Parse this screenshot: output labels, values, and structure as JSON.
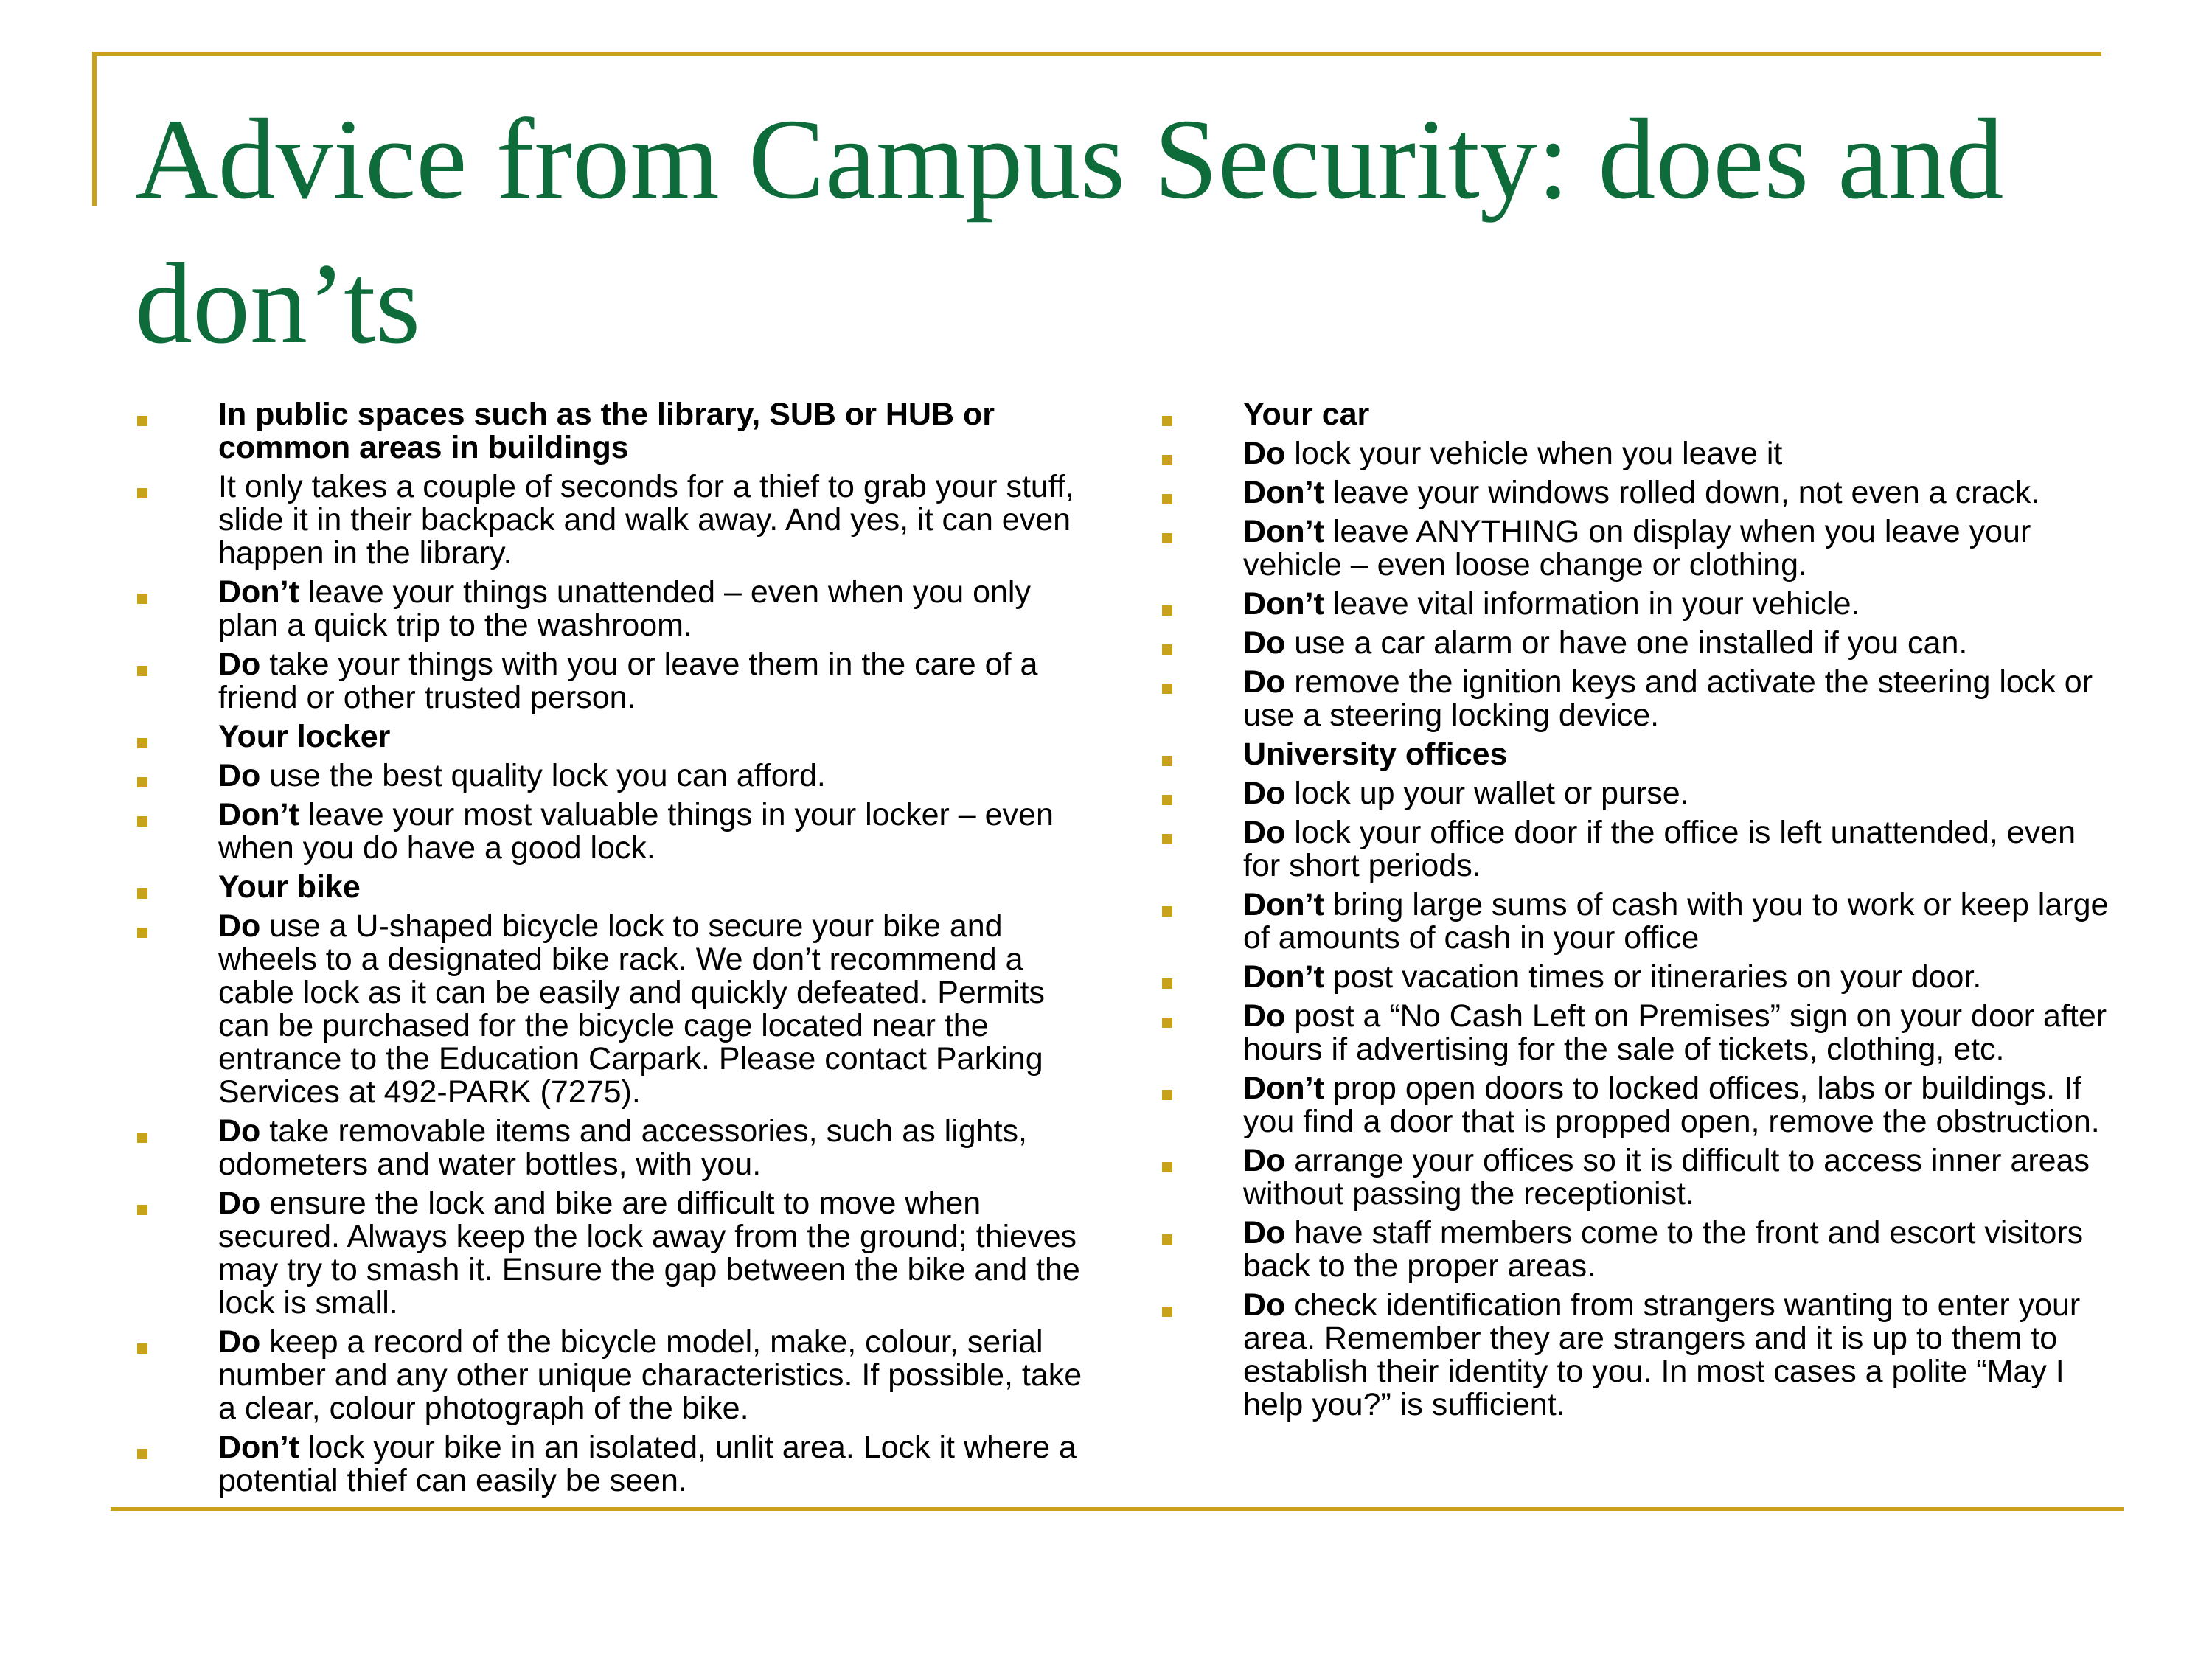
{
  "colors": {
    "accent": "#C9A21B",
    "title": "#0E6B3A"
  },
  "title": "Advice from Campus Security: does and don’ts",
  "left_column": [
    {
      "lead": "In public spaces such as the library, SUB or HUB or common areas in buildings",
      "text": ""
    },
    {
      "lead": "",
      "text": "It only takes a couple of seconds for a thief to grab your stuff, slide it in their backpack and walk away. And yes, it can even happen in the library."
    },
    {
      "lead": "Don’t",
      "text": " leave your things unattended – even when you only plan a quick trip to the washroom."
    },
    {
      "lead": "Do",
      "text": " take your things with you or leave them in the care of a friend or other trusted person."
    },
    {
      "lead": "Your locker",
      "text": ""
    },
    {
      "lead": "Do",
      "text": " use the best quality lock you can afford."
    },
    {
      "lead": "Don’t",
      "text": " leave your most valuable things in your locker – even when you do have a good lock."
    },
    {
      "lead": "Your bike",
      "text": ""
    },
    {
      "lead": "Do",
      "text": " use a U-shaped bicycle lock to secure your bike and wheels to a designated bike rack. We don’t recommend a cable lock as it can be easily and quickly defeated. Permits can be purchased for the bicycle cage located near the entrance to the Education Carpark. Please contact Parking Services at 492-PARK (7275)."
    },
    {
      "lead": "Do",
      "text": " take removable items and accessories, such as lights, odometers and water bottles, with you."
    },
    {
      "lead": "Do",
      "text": " ensure the lock and bike are difficult to move when secured. Always keep the lock away from the ground; thieves may try to smash it. Ensure the gap between the bike and the lock is small."
    },
    {
      "lead": "Do",
      "text": " keep a record of the bicycle model, make, colour, serial number and any other unique characteristics. If possible, take a clear, colour photograph of the bike."
    },
    {
      "lead": "Don’t",
      "text": " lock your bike in an isolated, unlit area. Lock it where a potential thief can easily be seen."
    }
  ],
  "right_column": [
    {
      "lead": "Your car",
      "text": ""
    },
    {
      "lead": "Do",
      "text": " lock your vehicle when you leave it"
    },
    {
      "lead": "Don’t",
      "text": " leave your windows rolled down, not even a crack."
    },
    {
      "lead": "Don’t",
      "text": " leave ANYTHING on display when you leave your vehicle – even loose change or clothing."
    },
    {
      "lead": "Don’t",
      "text": " leave vital information in your vehicle."
    },
    {
      "lead": "Do",
      "text": " use a car alarm or have one installed if you can."
    },
    {
      "lead": "Do",
      "text": " remove the ignition keys and activate the steering lock or use a steering locking device."
    },
    {
      "lead": "University offices",
      "text": ""
    },
    {
      "lead": "Do",
      "text": " lock up your wallet or purse."
    },
    {
      "lead": "Do",
      "text": " lock your office door if the office is left unattended, even for short periods."
    },
    {
      "lead": "Don’t",
      "text": " bring large sums of cash with you to work or keep large of amounts of cash in your office"
    },
    {
      "lead": "Don’t",
      "text": " post vacation times or itineraries on your door."
    },
    {
      "lead": "Do",
      "text": " post a “No Cash Left on Premises” sign on your door after hours if advertising for the sale of tickets, clothing, etc."
    },
    {
      "lead": "Don’t",
      "text": " prop open doors to locked offices, labs or buildings. If you find a door that is propped open, remove the obstruction."
    },
    {
      "lead": "Do",
      "text": " arrange your offices so it is difficult to access inner areas without passing the receptionist."
    },
    {
      "lead": "Do",
      "text": " have staff members come to the front and escort visitors back to the proper areas."
    },
    {
      "lead": "Do",
      "text": " check identification from strangers wanting to enter your area. Remember they are strangers and it is up to them to establish their identity to you. In most cases a polite “May I help you?” is sufficient."
    }
  ]
}
